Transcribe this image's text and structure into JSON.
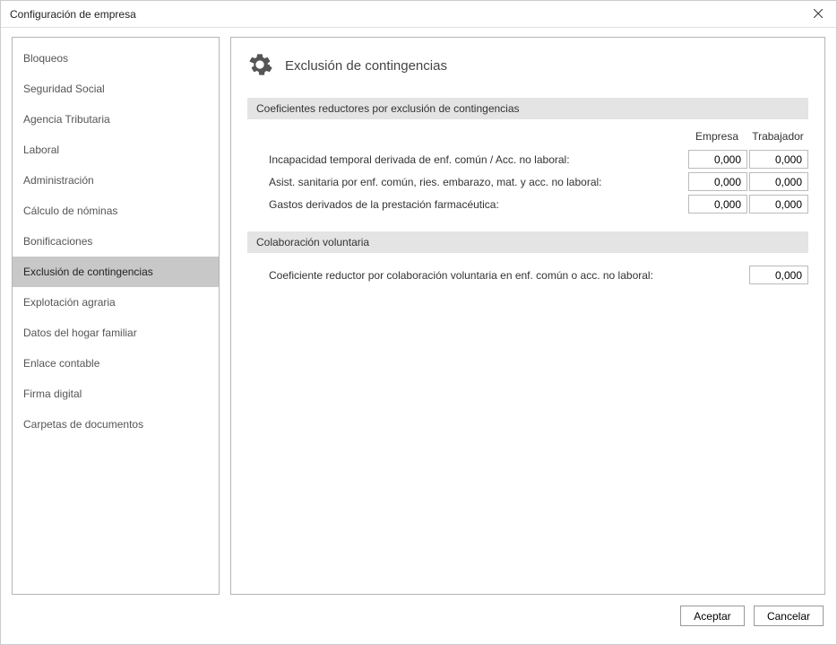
{
  "window": {
    "title": "Configuración de empresa"
  },
  "sidebar": {
    "items": [
      {
        "label": "Bloqueos",
        "selected": false
      },
      {
        "label": "Seguridad Social",
        "selected": false
      },
      {
        "label": "Agencia Tributaria",
        "selected": false
      },
      {
        "label": "Laboral",
        "selected": false
      },
      {
        "label": "Administración",
        "selected": false
      },
      {
        "label": "Cálculo de nóminas",
        "selected": false
      },
      {
        "label": "Bonificaciones",
        "selected": false
      },
      {
        "label": "Exclusión de contingencias",
        "selected": true
      },
      {
        "label": "Explotación agraria",
        "selected": false
      },
      {
        "label": "Datos del hogar familiar",
        "selected": false
      },
      {
        "label": "Enlace contable",
        "selected": false
      },
      {
        "label": "Firma digital",
        "selected": false
      },
      {
        "label": "Carpetas de documentos",
        "selected": false
      }
    ]
  },
  "main": {
    "title": "Exclusión de contingencias",
    "section1": {
      "header": "Coeficientes reductores por exclusión de contingencias",
      "col_empresa": "Empresa",
      "col_trabajador": "Trabajador",
      "rows": [
        {
          "label": "Incapacidad temporal derivada de enf. común / Acc. no laboral:",
          "empresa": "0,000",
          "trabajador": "0,000"
        },
        {
          "label": "Asist. sanitaria por enf. común, ries. embarazo, mat. y acc. no laboral:",
          "empresa": "0,000",
          "trabajador": "0,000"
        },
        {
          "label": "Gastos derivados de la prestación farmacéutica:",
          "empresa": "0,000",
          "trabajador": "0,000"
        }
      ]
    },
    "section2": {
      "header": "Colaboración voluntaria",
      "label": "Coeficiente reductor por colaboración voluntaria en enf. común o acc. no laboral:",
      "value": "0,000"
    }
  },
  "footer": {
    "accept": "Aceptar",
    "cancel": "Cancelar"
  }
}
